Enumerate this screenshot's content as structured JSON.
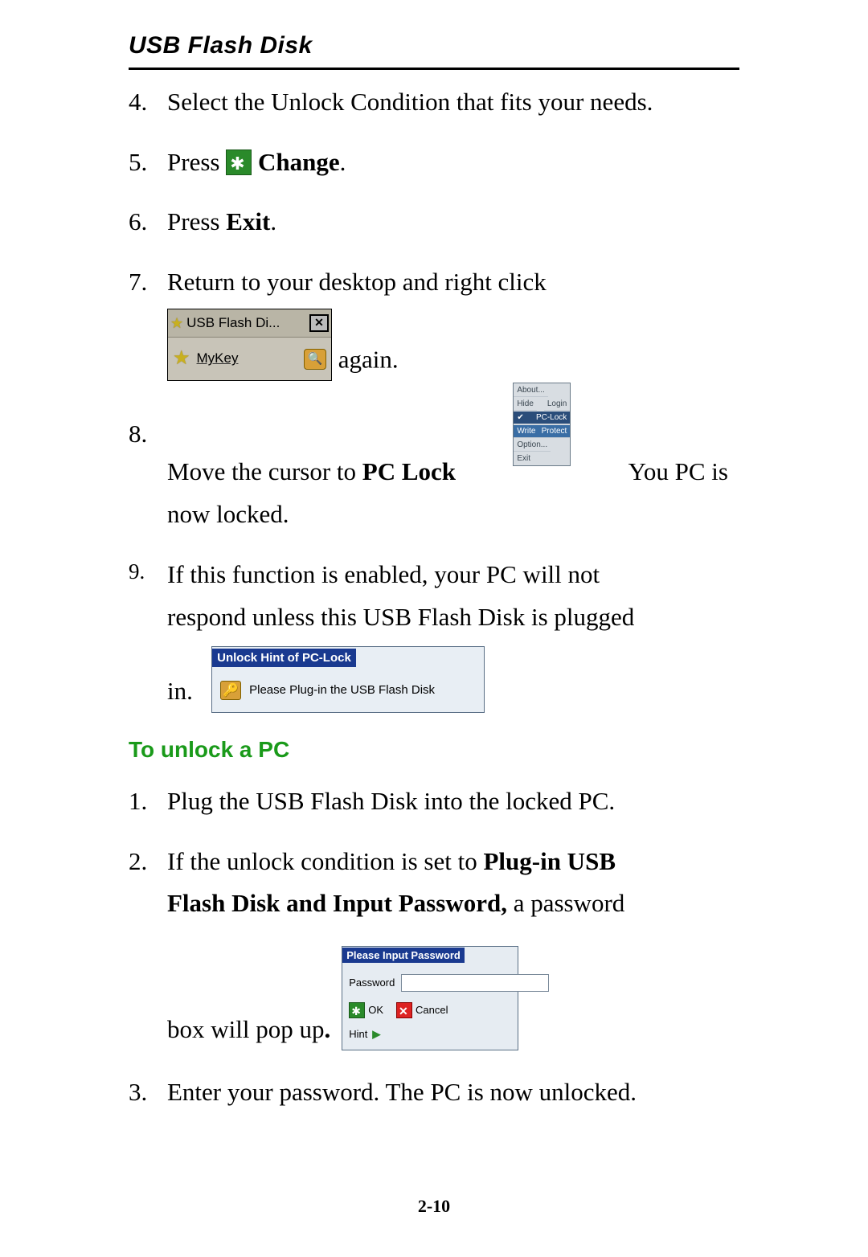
{
  "doc_title": "USB Flash Disk",
  "list_a": {
    "i4": {
      "num": "4.",
      "text": "Select the Unlock Condition that fits your needs."
    },
    "i5": {
      "num": "5.",
      "text_a": "Press ",
      "bold": " Change",
      "dot": "."
    },
    "i6": {
      "num": "6.",
      "text_a": "Press ",
      "bold": "Exit",
      "dot": "."
    },
    "i7": {
      "num": "7.",
      "line1": "Return  to  your  desktop  and  right  click",
      "after_img": " again."
    },
    "i8": {
      "num": "8.",
      "a": "Move the cursor to ",
      "bold": "PC Lock",
      "b": "  You PC is",
      "line2": "now locked."
    },
    "i9": {
      "num": "9.",
      "line1": "If  this  function  is  enabled,  your  PC  will  not",
      "line2": "respond unless this USB Flash Disk is plugged",
      "after_img": "in."
    }
  },
  "mykey": {
    "title": "USB Flash Di...",
    "label": "MyKey"
  },
  "ctx": {
    "items": [
      "About...",
      "Hide",
      "Login",
      "PC-Lock",
      "Write Protect",
      "Option...",
      "Exit"
    ],
    "sel_index": 3,
    "highlight_index": 4
  },
  "hint": {
    "title": "Unlock Hint of PC-Lock",
    "msg": "Please Plug-in the USB Flash Disk"
  },
  "section": "To unlock a PC",
  "list_b": {
    "i1": {
      "num": "1.",
      "text": "Plug the USB Flash Disk into the locked PC."
    },
    "i2": {
      "num": "2.",
      "a": "If  the  unlock  condition  is  set  to ",
      "b1": "Plug-in  USB",
      "b2": "Flash Disk and Input Password,",
      "c": " a password",
      "d": "box will pop up",
      "dot": "."
    },
    "i3": {
      "num": "3.",
      "text": "Enter your password. The PC is now unlocked."
    }
  },
  "pwd": {
    "title": "Please Input Password",
    "label": "Password",
    "placeholder": "",
    "ok": "OK",
    "cancel": "Cancel",
    "hint": "Hint"
  },
  "page_num": "2-10"
}
